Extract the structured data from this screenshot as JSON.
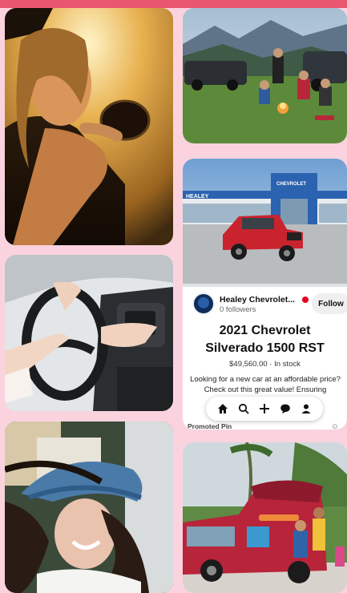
{
  "app": {
    "accent": "#e8576f",
    "background": "#fbd3de"
  },
  "pins": [
    {
      "name": "woman-car-window-sunset"
    },
    {
      "name": "campers-around-fire"
    },
    {
      "name": "hands-on-steering-wheel"
    },
    {
      "name": "woman-in-cap-laughing"
    },
    {
      "name": "family-loading-red-suv"
    }
  ],
  "promoted_pin": {
    "dealer_sign": "HEALEY",
    "brand_sign": "CHEVROLET",
    "advertiser": {
      "name": "Healey Chevrolet...",
      "followers": "0 followers",
      "verified_color": "#e60023"
    },
    "follow_label": "Follow",
    "title_line1": "2021 Chevrolet",
    "title_line2": "Silverado 1500 RST",
    "price_line": "$49,560.00 · In stock",
    "description": "Looking for a new car at an affordable price? Check out this great value! Ensuring",
    "promoted_label": "Promoted Pin",
    "nav_icons": [
      "home-icon",
      "search-icon",
      "plus-icon",
      "chat-icon",
      "profile-icon"
    ]
  }
}
